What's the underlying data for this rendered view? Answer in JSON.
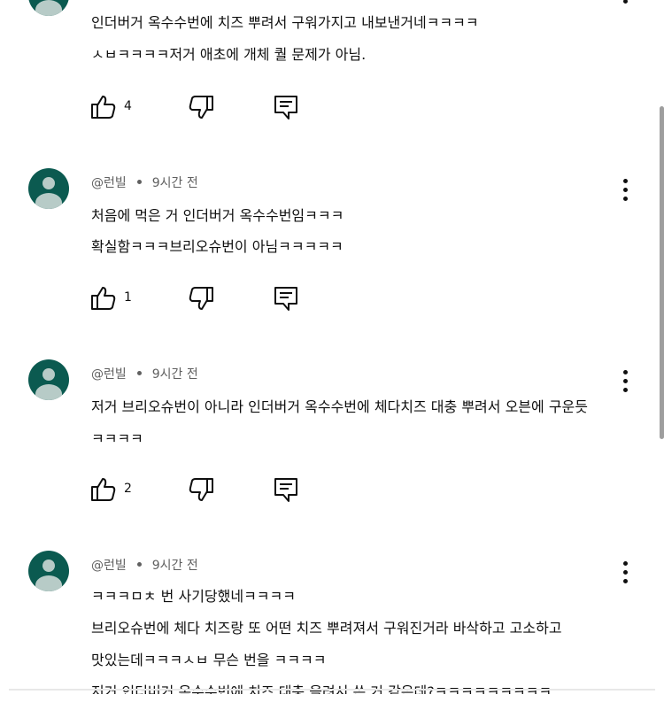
{
  "comments": [
    {
      "lines": [
        "인더버거 옥수수번에 치즈 뿌려서 구워가지고 내보낸거네ㅋㅋㅋㅋ",
        "ㅅㅂㅋㅋㅋㅋ저거 애초에 개체 퀄 문제가 아님."
      ],
      "likes": "4"
    },
    {
      "handle": "@런빌",
      "time": "9시간 전",
      "lines": [
        "처음에 먹은 거 인더버거 옥수수번임ㅋㅋㅋ",
        "확실함ㅋㅋㅋ브리오슈번이 아님ㅋㅋㅋㅋㅋ"
      ],
      "likes": "1"
    },
    {
      "handle": "@런빌",
      "time": "9시간 전",
      "lines": [
        "저거 브리오슈번이 아니라 인더버거 옥수수번에 체다치즈 대충 뿌려서 오븐에 구운듯",
        "ㅋㅋㅋㅋ"
      ],
      "likes": "2"
    },
    {
      "handle": "@런빌",
      "time": "9시간 전",
      "lines": [
        "ㅋㅋㅋㅁㅊ 번 사기당했네ㅋㅋㅋㅋ",
        "브리오슈번에 체다 치즈랑 또 어떤 치즈 뿌려져서 구워진거라 바삭하고 고소하고",
        "맛있는데ㅋㅋㅋㅅㅂ 무슨 번을 ㅋㅋㅋㅋ",
        "저거 인더버거 옥수수번에 치즈 대충 올려서 쓴 거 같은데?ㅋㅋㅋㅋㅋㅋㅋㅋㅋ"
      ]
    }
  ],
  "icons": {
    "like": "thumbs-up-icon",
    "dislike": "thumbs-down-icon",
    "reply": "reply-icon",
    "menu": "more-vert-icon"
  },
  "colors": {
    "avatar": "#0b5a50",
    "avatar_fg": "#b7cbc7",
    "meta": "#606060",
    "text": "#0f0f0f"
  }
}
